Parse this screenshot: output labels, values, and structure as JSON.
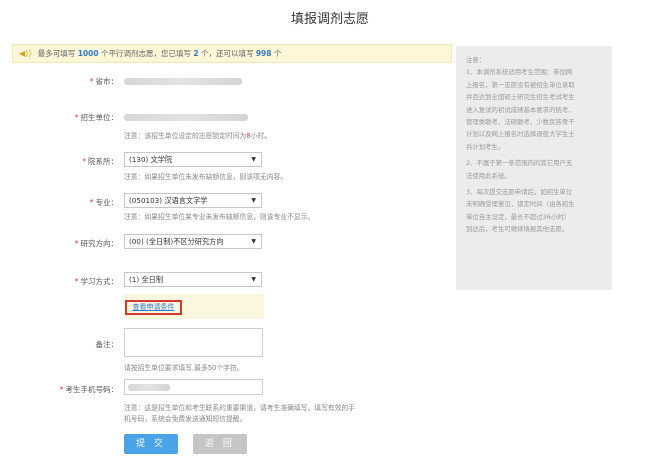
{
  "page": {
    "title": "填报调剂志愿"
  },
  "notice": {
    "text_1": "最多可填写",
    "max_count": "1000",
    "text_2": "个平行调剂志愿，您已填写",
    "filled_count": "2",
    "text_3": "个，还可以填写",
    "remaining_count": "998",
    "text_4": "个"
  },
  "form": {
    "province": {
      "label": "省市："
    },
    "institution": {
      "label": "招生单位：",
      "hint_1": "注意：该招生单位设定的志愿锁定时间为",
      "hint_red": "8",
      "hint_2": "小时。"
    },
    "department": {
      "label": "院系所：",
      "value": "(130) 文学院",
      "hint": "注意：如果招生单位未发布缺额信息，则该项无内容。"
    },
    "major": {
      "label": "专业：",
      "value": "(050103) 汉语言文字学",
      "hint": "注意：如果招生单位某专业未发布缺额信息，则该专业不显示。"
    },
    "research": {
      "label": "研究方向：",
      "value": "(00) (全日制)不区分研究方向"
    },
    "study_mode": {
      "label": "学习方式：",
      "value": "(1) 全日制"
    },
    "criteria_link": "查看申请条件",
    "remarks": {
      "label": "备注：",
      "hint": "请按招生单位要求填写,最多50个字符。"
    },
    "phone": {
      "label": "考生手机号码：",
      "hint_line1": "注意：这是招生单位和考生联系的重要渠道，请考生准确填写。填写有效的手",
      "hint_line2": "机号码，系统会免费发送通知短信提醒。"
    },
    "buttons": {
      "submit": "提 交",
      "back": "返 回"
    },
    "colors": {
      "primary": "#4aa3e8",
      "disabled": "#c5c5c5",
      "required": "#e23b3b",
      "highlight_border": "#d23a2e"
    }
  },
  "sidebar": {
    "title": "注意：",
    "item1": [
      "1、本调剂系统适用考生范围：参加网",
      "上报名，第一志愿没有被招生单位录取",
      "并且达到全国硕士研究生招生考试考生",
      "进入复试的初试成绩基本要求的统考、",
      "管理类联考、法硕联考、少数民族骨干",
      "计划以及网上报名时选择退役大学生士",
      "兵计划考生。"
    ],
    "item2": [
      "2、不属于第一条范围内的其它用户无",
      "法使用此系统。"
    ],
    "item3": [
      "3、每次提交志愿申请后，如招生单位",
      "未明确受理意见，锁定时间（由各招生",
      "单位自主设定，最长不超过36小时）",
      "到达后，考生可继续填报其他志愿。"
    ]
  }
}
